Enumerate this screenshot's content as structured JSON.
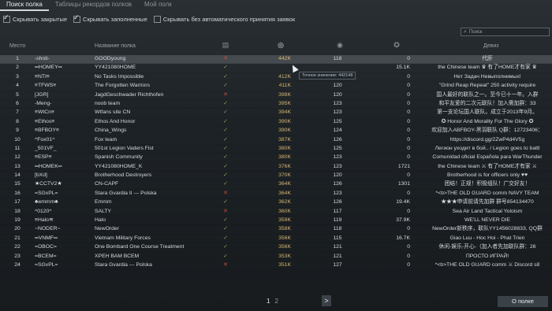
{
  "tabs": [
    "Поиск полка",
    "Таблицы рекордов полков",
    "Мой полк"
  ],
  "filters": [
    {
      "label": "Скрывать закрытые",
      "checked": true
    },
    {
      "label": "Скрывать заполненные",
      "checked": true
    },
    {
      "label": "Скрывать без автоматического принятия заявок",
      "checked": false
    }
  ],
  "search": {
    "placeholder": "Поиск"
  },
  "header": {
    "rank": "Место",
    "name": "Название полка",
    "motto": "Девиз"
  },
  "tooltip": "Точное значение: 442148",
  "rows": [
    {
      "rank": "1",
      "tag": "-shoti-",
      "name": "GOODyoung",
      "ok": false,
      "val": "442K",
      "n1": "118",
      "n2": "0",
      "motto": "代肝"
    },
    {
      "rank": "2",
      "tag": "═HOMEY═",
      "name": "YY421080HOME",
      "ok": true,
      "val": "",
      "n1": "",
      "n2": "15.1K",
      "motto": "the Chinese team ♛ 有了HOME才有家 ♛"
    },
    {
      "rank": "3",
      "tag": "≡NTI≡",
      "name": "No Tasks Impossible",
      "ok": true,
      "val": "412K",
      "n1": "119",
      "n2": "0",
      "motto": "Нет Задач Невыполнимых!"
    },
    {
      "rank": "4",
      "tag": "≡TFWS≡",
      "name": "The Forgotten Warriors",
      "ok": true,
      "val": "411K",
      "n1": "120",
      "n2": "0",
      "motto": "\"Grind Reap Repeat\"    250 activity require"
    },
    {
      "rank": "5",
      "tag": "[JGR]",
      "name": "JagdGeschwader Richthofen",
      "ok": false,
      "val": "398K",
      "n1": "120",
      "n2": "0",
      "motto": "国人最好的联队之一。至今已十一年。入群"
    },
    {
      "rank": "6",
      "tag": "-Meng-",
      "name": "noob team",
      "ok": true,
      "val": "395K",
      "n1": "123",
      "n2": "0",
      "motto": "和平友爱的二次元联队！加入需加群：33"
    },
    {
      "rank": "7",
      "tag": "≡WtCn≡",
      "name": "Wtfans site CN",
      "ok": true,
      "val": "394K",
      "n1": "123",
      "n2": "0",
      "motto": "第一支论坛国人联队。成立于2013年9月。"
    },
    {
      "rank": "8",
      "tag": "≡Ethos≡",
      "name": "Ethos And Honor",
      "ok": true,
      "val": "390K",
      "n1": "125",
      "n2": "0",
      "motto": "✪ Honor And Morality For The Glory ✪"
    },
    {
      "rank": "9",
      "tag": "≡BFBOY≡",
      "name": "China_Wings",
      "ok": true,
      "val": "390K",
      "n1": "124",
      "n2": "0",
      "motto": "欢迎加入ABFBOY-黑羽联队 Q群：12723406："
    },
    {
      "rank": "10",
      "tag": "^Fox01^",
      "name": "Fox team",
      "ok": true,
      "val": "387K",
      "n1": "126",
      "n2": "0",
      "motto": "https://discord.gg/2ZwP4d4V5g"
    },
    {
      "rank": "11",
      "tag": "_501VF_",
      "name": "501st Legion Vaders Fist",
      "ok": true,
      "val": "380K",
      "n1": "125",
      "n2": "0",
      "motto": "Легион уходит в бой.. / Legion goes to battl"
    },
    {
      "rank": "12",
      "tag": "≡ESP≡",
      "name": "Spanish Community",
      "ok": true,
      "val": "380K",
      "n1": "123",
      "n2": "0",
      "motto": "Comunidad oficial Española para WarThunder"
    },
    {
      "rank": "13",
      "tag": "═HOMEK═",
      "name": "YY421080HOME_K",
      "ok": true,
      "val": "376K",
      "n1": "123",
      "n2": "1721",
      "motto": "the Chinese team ⚔ 有了HOME才有家 ⚔"
    },
    {
      "rank": "14",
      "tag": "[bXd]",
      "name": "Brotherhood Destroyers",
      "ok": true,
      "val": "370K",
      "n1": "120",
      "n2": "0",
      "motto": "Brotherhood is for officers only ♥♥"
    },
    {
      "rank": "15",
      "tag": "★CCTV2★",
      "name": "CN-CAPF",
      "ok": true,
      "val": "364K",
      "n1": "126",
      "n2": "1301",
      "motto": "团结！正规！积极组队！广交好友！"
    },
    {
      "rank": "16",
      "tag": "=SGxPL=",
      "name": "Stara Gvardia II --- Polska",
      "ok": false,
      "val": "364K",
      "n1": "123",
      "n2": "0",
      "motto": "*<b>THE OLD GUARD comm  NAVY TEAM"
    },
    {
      "rank": "17",
      "tag": "♣emmm♣",
      "name": "Emmm",
      "ok": true,
      "val": "362K",
      "n1": "126",
      "n2": "19.4K",
      "motto": "★★★申请前请先加群 群号854134470"
    },
    {
      "rank": "18",
      "tag": "^0120^",
      "name": "SALTY",
      "ok": false,
      "val": "360K",
      "n1": "117",
      "n2": "0",
      "motto": "Sea Air Land Tactical Yoloism"
    },
    {
      "rank": "19",
      "tag": "≡Halo≋",
      "name": "Halo",
      "ok": true,
      "val": "359K",
      "n1": "119",
      "n2": "37.9K",
      "motto": "WE'LL NEVER DIE"
    },
    {
      "rank": "20",
      "tag": "~NODER~",
      "name": "NewOrder",
      "ok": true,
      "val": "358K",
      "n1": "118",
      "n2": "0",
      "motto": "NewOrder新秩序，联队YY1456028833, QQ群"
    },
    {
      "rank": "21",
      "tag": "═VNMF═",
      "name": "Vietnam Military Forces",
      "ok": true,
      "val": "356K",
      "n1": "115",
      "n2": "16.7K",
      "motto": "Giao Luu - Hoc Hoi - Phat Trien"
    },
    {
      "rank": "22",
      "tag": "=OBOC=",
      "name": "One Bombard One Course Treatment",
      "ok": true,
      "val": "356K",
      "n1": "121",
      "n2": "0",
      "motto": "休闲-娱乐-开心-（加入者先加联队群：26"
    },
    {
      "rank": "23",
      "tag": "=BCEM=",
      "name": "ХРЕН ВАМ ВСЕМ",
      "ok": true,
      "val": "353K",
      "n1": "121",
      "n2": "0",
      "motto": "ПРОСТО ИГРАЙ!"
    },
    {
      "rank": "24",
      "tag": "=SGvPL=",
      "name": "Stara Gvardia --- Polska",
      "ok": false,
      "val": "351K",
      "n1": "127",
      "n2": "0",
      "motto": "*<b>THE OLD GUARD comm  ⚔ Discord s8"
    }
  ],
  "pager": {
    "current": "1",
    "other": "2",
    "next": ">"
  },
  "about_button": "О полке"
}
